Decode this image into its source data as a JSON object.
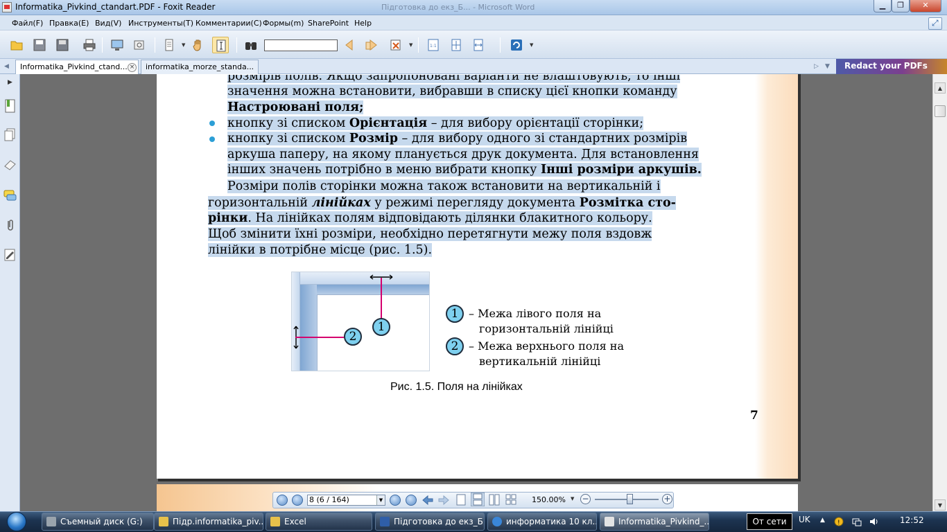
{
  "window": {
    "title": "Informatika_Pivkind_ctandart.PDF - Foxit Reader",
    "background_title": "Підготовка до екз_Б... - Microsoft Word",
    "minimize": "▁",
    "maximize": "❐",
    "close": "✕"
  },
  "menu": {
    "items": [
      "Файл(F)",
      "Правка(E)",
      "Вид(V)",
      "Инструменты(T)",
      "Комментарии(C)",
      "Формы(m)",
      "SharePoint",
      "Help"
    ]
  },
  "toolbar": {
    "search_value": ""
  },
  "tabs": {
    "items": [
      {
        "label": "Informatika_Pivkind_ctand...",
        "active": true
      },
      {
        "label": "informatika_morze_standa...",
        "active": false
      }
    ],
    "close_glyph": "×",
    "promo": "Redact your PDFs"
  },
  "document": {
    "lines": {
      "l0": "розмірів полів. Якщо запропоновані варіанти не влаштовують, то інші",
      "l1": "значення можна встановити, вибравши в списку цієї кнопки команду",
      "l2": "Настроювані поля;",
      "l3a": "кнопку зі списком ",
      "l3b": "Орієнтація",
      "l3c": " – для вибору орієнтації сторінки;",
      "l4a": "кнопку зі списком ",
      "l4b": "Розмір",
      "l4c": " – для вибору одного зі стандартних розмірів",
      "l5": "аркуша паперу, на якому планується друк документа. Для встановлення",
      "l6a": "інших значень потрібно в меню вибрати кнопку ",
      "l6b": "Інші розміри аркушів.",
      "l7": "Розміри полів сторінки можна також встановити на вертикальній і",
      "l8a": "горизонтальній ",
      "l8b": "лінійках",
      "l8c": " у режимі перегляду документа ",
      "l8d": "Розмітка сто-",
      "l9a": "рінки",
      "l9b": ". На лінійках полям відповідають ділянки блакитного кольору.",
      "l10": "Щоб змінити їхні розміри, необхідно перетягнути межу поля вздовж",
      "l11": "лінійки в потрібне місце (рис. 1.5)."
    },
    "figure": {
      "marker1": "1",
      "marker2": "2",
      "legend1_line1": "– Межа лівого поля на",
      "legend1_line2": "горизонтальній лінійці",
      "legend2_line1": "– Межа верхнього поля на",
      "legend2_line2": "вертикальній лінійці",
      "caption": "Рис. 1.5. Поля на лінійках"
    },
    "page_number": "7",
    "highlight_color": "#c6d9ed",
    "bullet_color": "#2c9fd6"
  },
  "navigation": {
    "page_indicator": "8 (6 / 164)",
    "zoom": "150.00%",
    "zoom_out": "−",
    "zoom_in": "+"
  },
  "taskbar": {
    "items": [
      {
        "label": "Съемный диск (G:)",
        "color": "#9aa4ad"
      },
      {
        "label": "Підр.informatika_piv...",
        "color": "#e7c14b"
      },
      {
        "label": "Excel",
        "color": "#e7c14b"
      },
      {
        "label": "Підготовка до екз_Б...",
        "color": "#2f5ea8"
      },
      {
        "label": "информатика 10 кл...",
        "color": "#3a86d8"
      },
      {
        "label": "Informatika_Pivkind_...",
        "color": "#e3e3e3"
      }
    ],
    "tooltip": "От сети",
    "language": "UK",
    "clock": "12:52"
  }
}
